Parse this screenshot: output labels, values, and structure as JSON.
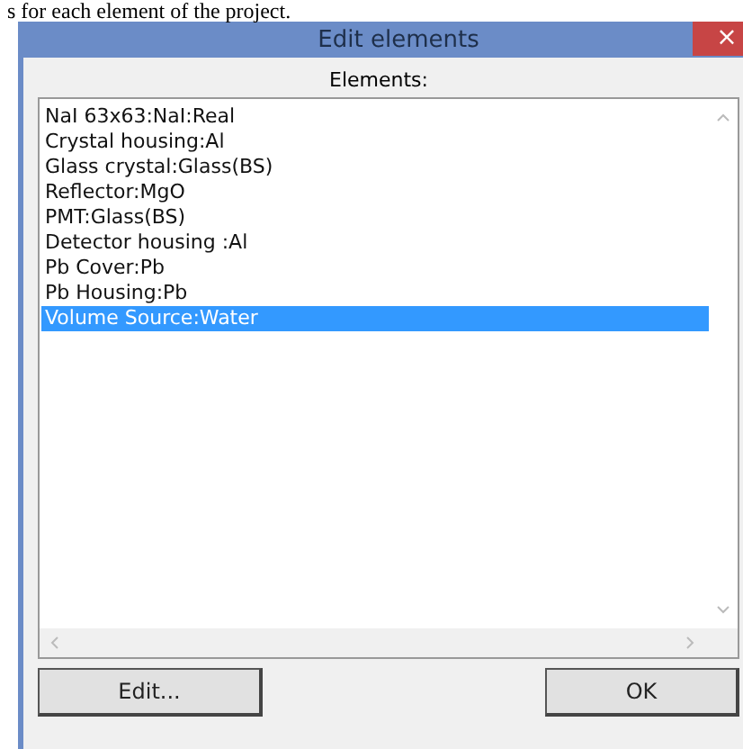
{
  "document_text": "s for each element of the project.",
  "window": {
    "title": "Edit elements",
    "close": "×"
  },
  "list_label": "Elements:",
  "elements": [
    {
      "label": "NaI 63x63:NaI:Real",
      "selected": false
    },
    {
      "label": "Crystal housing:Al",
      "selected": false
    },
    {
      "label": "Glass crystal:Glass(BS)",
      "selected": false
    },
    {
      "label": "Reflector:MgO",
      "selected": false
    },
    {
      "label": "PMT:Glass(BS)",
      "selected": false
    },
    {
      "label": "Detector housing :Al",
      "selected": false
    },
    {
      "label": "Pb Cover:Pb",
      "selected": false
    },
    {
      "label": "Pb Housing:Pb",
      "selected": false
    },
    {
      "label": "Volume Source:Water",
      "selected": true
    }
  ],
  "buttons": [
    "Edit...",
    "OK"
  ]
}
